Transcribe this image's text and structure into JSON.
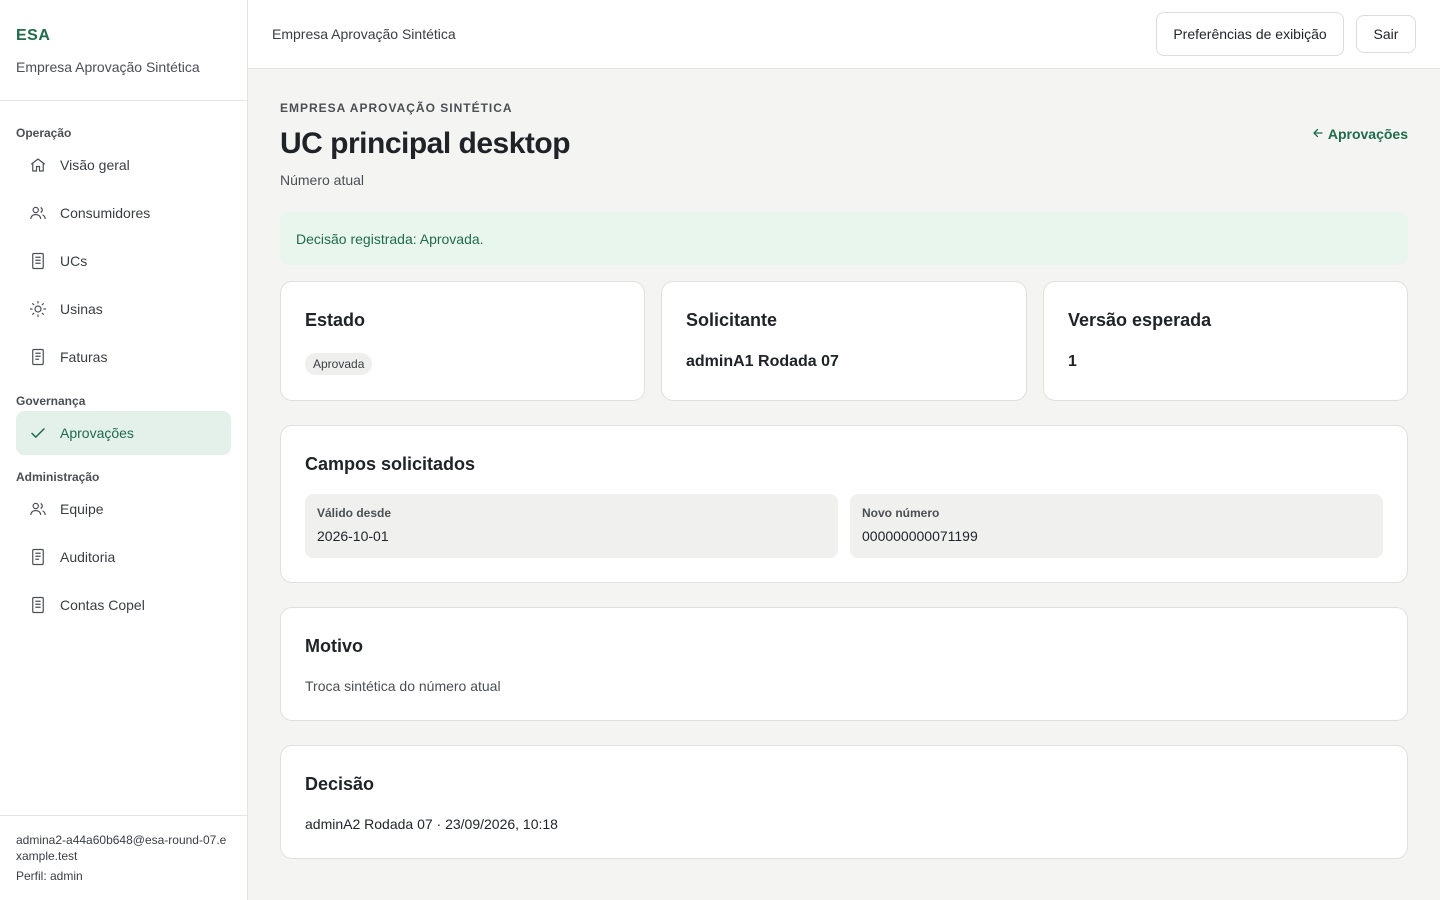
{
  "brand": {
    "short": "ESA",
    "name": "Empresa Aprovação Sintética"
  },
  "sidebar": {
    "groups": [
      {
        "title": "Operação",
        "items": [
          {
            "label": "Visão geral",
            "icon": "home-icon"
          },
          {
            "label": "Consumidores",
            "icon": "users-icon"
          },
          {
            "label": "UCs",
            "icon": "document-icon"
          },
          {
            "label": "Usinas",
            "icon": "sun-icon"
          },
          {
            "label": "Faturas",
            "icon": "file-icon"
          }
        ]
      },
      {
        "title": "Governança",
        "items": [
          {
            "label": "Aprovações",
            "icon": "check-icon",
            "active": true
          }
        ]
      },
      {
        "title": "Administração",
        "items": [
          {
            "label": "Equipe",
            "icon": "users-icon"
          },
          {
            "label": "Auditoria",
            "icon": "file-icon"
          },
          {
            "label": "Contas Copel",
            "icon": "document-icon"
          }
        ]
      }
    ],
    "user": {
      "email": "admina2-a44a60b648@esa-round-07.example.test",
      "role": "Perfil: admin"
    }
  },
  "topbar": {
    "title": "Empresa Aprovação Sintética",
    "prefs_label": "Preferências de exibição",
    "exit_label": "Sair"
  },
  "page": {
    "eyebrow": "EMPRESA APROVAÇÃO SINTÉTICA",
    "title": "UC principal desktop",
    "subtitle": "Número atual",
    "back_label": "Aprovações"
  },
  "alert": {
    "text": "Decisão registrada: Aprovada."
  },
  "stats": {
    "state": {
      "title": "Estado",
      "value": "Aprovada"
    },
    "requester": {
      "title": "Solicitante",
      "value": "adminA1 Rodada 07"
    },
    "version": {
      "title": "Versão esperada",
      "value": "1"
    }
  },
  "fields": {
    "title": "Campos solicitados",
    "items": [
      {
        "label": "Válido desde",
        "value": "2026-10-01"
      },
      {
        "label": "Novo número",
        "value": "000000000071199"
      }
    ]
  },
  "reason": {
    "title": "Motivo",
    "text": "Troca sintética do número atual"
  },
  "decision": {
    "title": "Decisão",
    "text": "adminA2 Rodada 07 · 23/09/2026, 10:18"
  },
  "colors": {
    "accent": "#1f6b4a",
    "accent_bg": "#e4f1ea",
    "alert_bg": "#e9f6ee"
  }
}
